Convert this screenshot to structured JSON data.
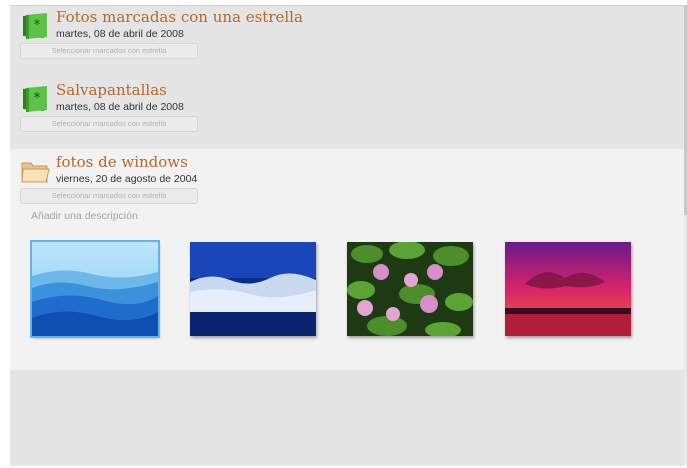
{
  "groups": [
    {
      "title": "Fotos marcadas con una estrella",
      "date": "martes, 08 de abril de 2008",
      "select_label": "Seleccionar marcados con estrella",
      "icon": "starred-album-icon"
    },
    {
      "title": "Salvapantallas",
      "date": "martes, 08 de abril de 2008",
      "select_label": "Seleccionar marcados con estrella",
      "icon": "starred-album-icon"
    },
    {
      "title": "fotos de windows",
      "date": "viernes, 20 de agosto de 2004",
      "select_label": "Seleccionar marcados con estrella",
      "icon": "folder-icon",
      "description_placeholder": "Añadir una descripción",
      "photos": [
        "blue-hills",
        "frosted-trees",
        "water-lilies",
        "sunset"
      ]
    }
  ],
  "colors": {
    "title": "#b5682a",
    "selection": "#5fb4ee",
    "album_icon": "#5cc24a"
  }
}
